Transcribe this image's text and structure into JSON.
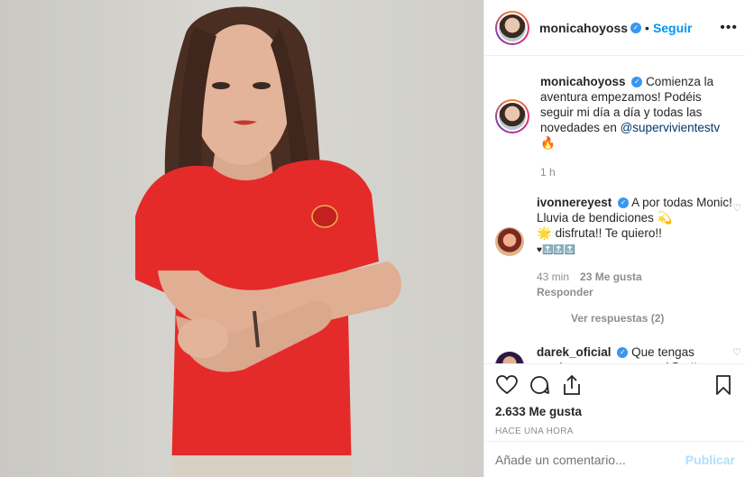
{
  "post": {
    "username": "monicahoyoss",
    "follow_label": "Seguir",
    "more_label": "•••"
  },
  "caption": {
    "username": "monicahoyoss",
    "text": "Comienza la aventura empezamos! Podéis seguir mi día a día y todas las novedades en",
    "mention": "@supervivientestv",
    "emoji": "🔥",
    "time": "1 h"
  },
  "comments": [
    {
      "username": "ivonnereyest",
      "text_1": "A por todas Monic! Lluvia de bendiciones",
      "emoji_1": "💫",
      "emoji_2": "🌟",
      "text_2": "disfruta!! Te quiero!!",
      "line_3": "♥🔝🔝🔝",
      "time": "43 min",
      "likes": "23 Me gusta",
      "reply_label": "Responder",
      "view_replies": "Ver respuestas (2)"
    },
    {
      "username": "darek_oficial",
      "text": "Que tengas mucha suerte , a por tod@s !!"
    }
  ],
  "stats": {
    "likes": "2.633 Me gusta",
    "time": "HACE UNA HORA"
  },
  "composer": {
    "placeholder": "Añade un comentario...",
    "post_label": "Publicar"
  },
  "icons": [
    "heart-icon",
    "comment-icon",
    "share-icon",
    "bookmark-icon",
    "verified-icon",
    "more-icon"
  ]
}
